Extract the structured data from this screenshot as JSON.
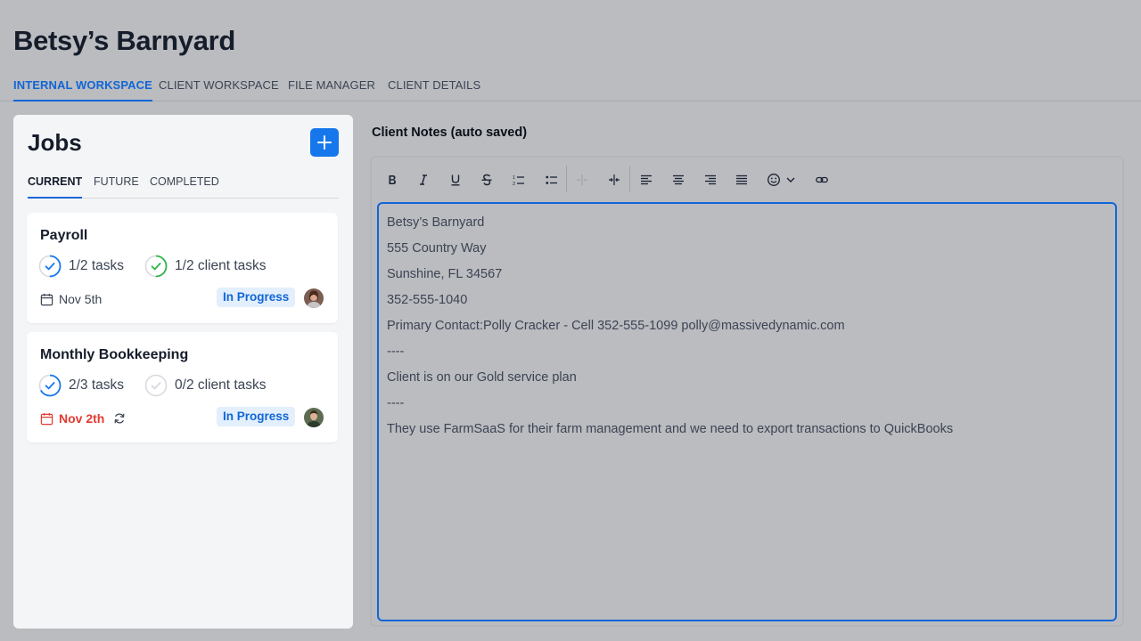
{
  "page": {
    "title": "Betsy’s Barnyard"
  },
  "top_tabs": [
    {
      "label": "INTERNAL WORKSPACE",
      "active": true
    },
    {
      "label": "CLIENT WORKSPACE",
      "active": false
    },
    {
      "label": "FILE MANAGER",
      "active": false
    },
    {
      "label": "CLIENT DETAILS",
      "active": false
    }
  ],
  "jobs": {
    "title": "Jobs",
    "tabs": [
      {
        "label": "CURRENT",
        "active": true
      },
      {
        "label": "FUTURE",
        "active": false
      },
      {
        "label": "COMPLETED",
        "active": false
      }
    ],
    "cards": [
      {
        "name": "Payroll",
        "tasks": "1/2 tasks",
        "tasks_done": 1,
        "tasks_total": 2,
        "client_tasks": "1/2 client tasks",
        "client_tasks_done": 1,
        "client_tasks_total": 2,
        "due": "Nov 5th",
        "overdue": false,
        "recurring": false,
        "status": "In Progress"
      },
      {
        "name": "Monthly Bookkeeping",
        "tasks": "2/3 tasks",
        "tasks_done": 2,
        "tasks_total": 3,
        "client_tasks": "0/2 client tasks",
        "client_tasks_done": 0,
        "client_tasks_total": 2,
        "due": "Nov 2th",
        "overdue": true,
        "recurring": true,
        "status": "In Progress"
      }
    ]
  },
  "notes": {
    "label": "Client Notes (auto saved)",
    "toolbar": [
      "bold-icon",
      "italic-icon",
      "underline-icon",
      "strikethrough-icon",
      "ordered-list-icon",
      "bullet-list-icon",
      "outdent-icon",
      "indent-icon",
      "align-left-icon",
      "align-center-icon",
      "align-right-icon",
      "justify-icon",
      "emoji-icon",
      "link-icon"
    ],
    "lines": [
      "Betsy’s Barnyard",
      "555 Country Way",
      "Sunshine, FL 34567",
      "352-555-1040",
      "Primary Contact:Polly Cracker - Cell 352-555-1099 polly@massivedynamic.com",
      "----",
      "Client is on our Gold service plan",
      "----",
      "They use FarmSaaS for their farm management and we need to export transactions to QuickBooks"
    ]
  },
  "colors": {
    "accent": "#1166d6",
    "success": "#2fb34a",
    "danger": "#e23b30",
    "background": "#bbbcc0"
  }
}
